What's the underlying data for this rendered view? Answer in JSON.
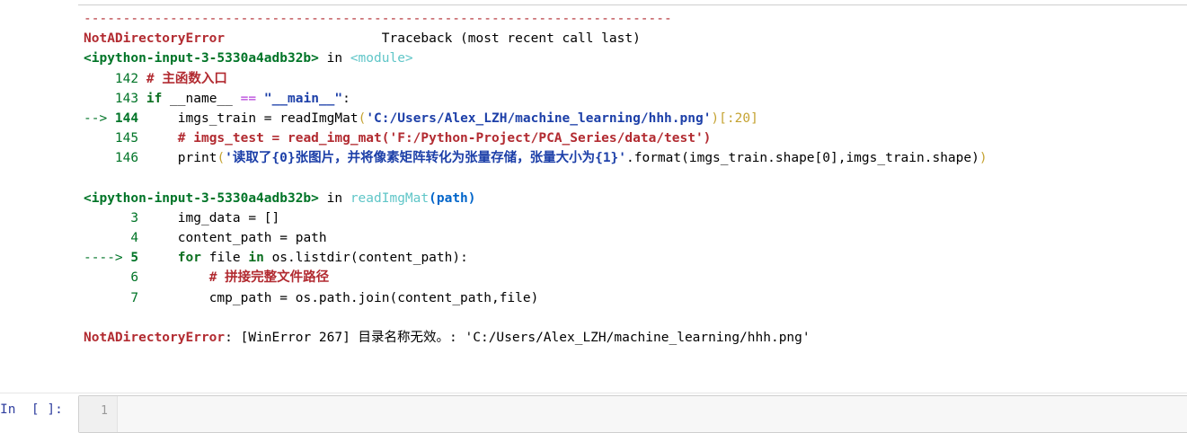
{
  "traceback": {
    "separator": "---------------------------------------------------------------------------",
    "error_name": "NotADirectoryError",
    "header_right": "Traceback (most recent call last)",
    "frame1": {
      "file": "<ipython-input-3-5330a4adb32b>",
      "in_word": " in ",
      "func": "<module>",
      "lines": [
        {
          "prefix": "    ",
          "num": "142",
          "code_comment": "# 主函数入口"
        },
        {
          "prefix": "    ",
          "num": "143",
          "kw_if": "if",
          "name_part": " __name__ ",
          "op": "==",
          "str": "\"__main__\"",
          "colon": ":"
        },
        {
          "prefix": "--> ",
          "num": "144",
          "indent": "    ",
          "code_a": "imgs_train = readImgMat",
          "paren_open": "(",
          "str": "'C:/Users/Alex_LZH/machine_learning/hhh.png'",
          "paren_close": ")",
          "slice": "[:20]"
        },
        {
          "prefix": "    ",
          "num": "145",
          "indent": "    ",
          "code_comment": "# imgs_test = read_img_mat('F:/Python-Project/PCA_Series/data/test')"
        },
        {
          "prefix": "    ",
          "num": "146",
          "indent": "    ",
          "code_a": "print",
          "paren_open": "(",
          "str": "'读取了{0}张图片，并将像素矩阵转化为张量存储，张量大小为{1}'",
          "code_b": ".format(imgs_train.shape[0],imgs_train.shape)",
          "paren_close": ")"
        }
      ]
    },
    "frame2": {
      "file": "<ipython-input-3-5330a4adb32b>",
      "in_word": " in ",
      "func": "readImgMat",
      "args": "(path)",
      "lines": [
        {
          "prefix": "      ",
          "num": "3",
          "indent": "    ",
          "code": "img_data = []"
        },
        {
          "prefix": "      ",
          "num": "4",
          "indent": "    ",
          "code": "content_path = path"
        },
        {
          "prefix": "----> ",
          "num": "5",
          "indent": "    ",
          "kw_for": "for",
          "mid": " file ",
          "kw_in": "in",
          "code": " os.listdir(content_path):"
        },
        {
          "prefix": "      ",
          "num": "6",
          "indent": "        ",
          "code_comment": "# 拼接完整文件路径"
        },
        {
          "prefix": "      ",
          "num": "7",
          "indent": "        ",
          "code": "cmp_path = os.path.join(content_path,file)"
        }
      ]
    },
    "final_error_name": "NotADirectoryError",
    "final_message": ": [WinError 267] 目录名称无效。: 'C:/Users/Alex_LZH/machine_learning/hhh.png'"
  },
  "input_cell": {
    "prompt": "In  [ ]:",
    "line_number": "1",
    "code": ""
  }
}
